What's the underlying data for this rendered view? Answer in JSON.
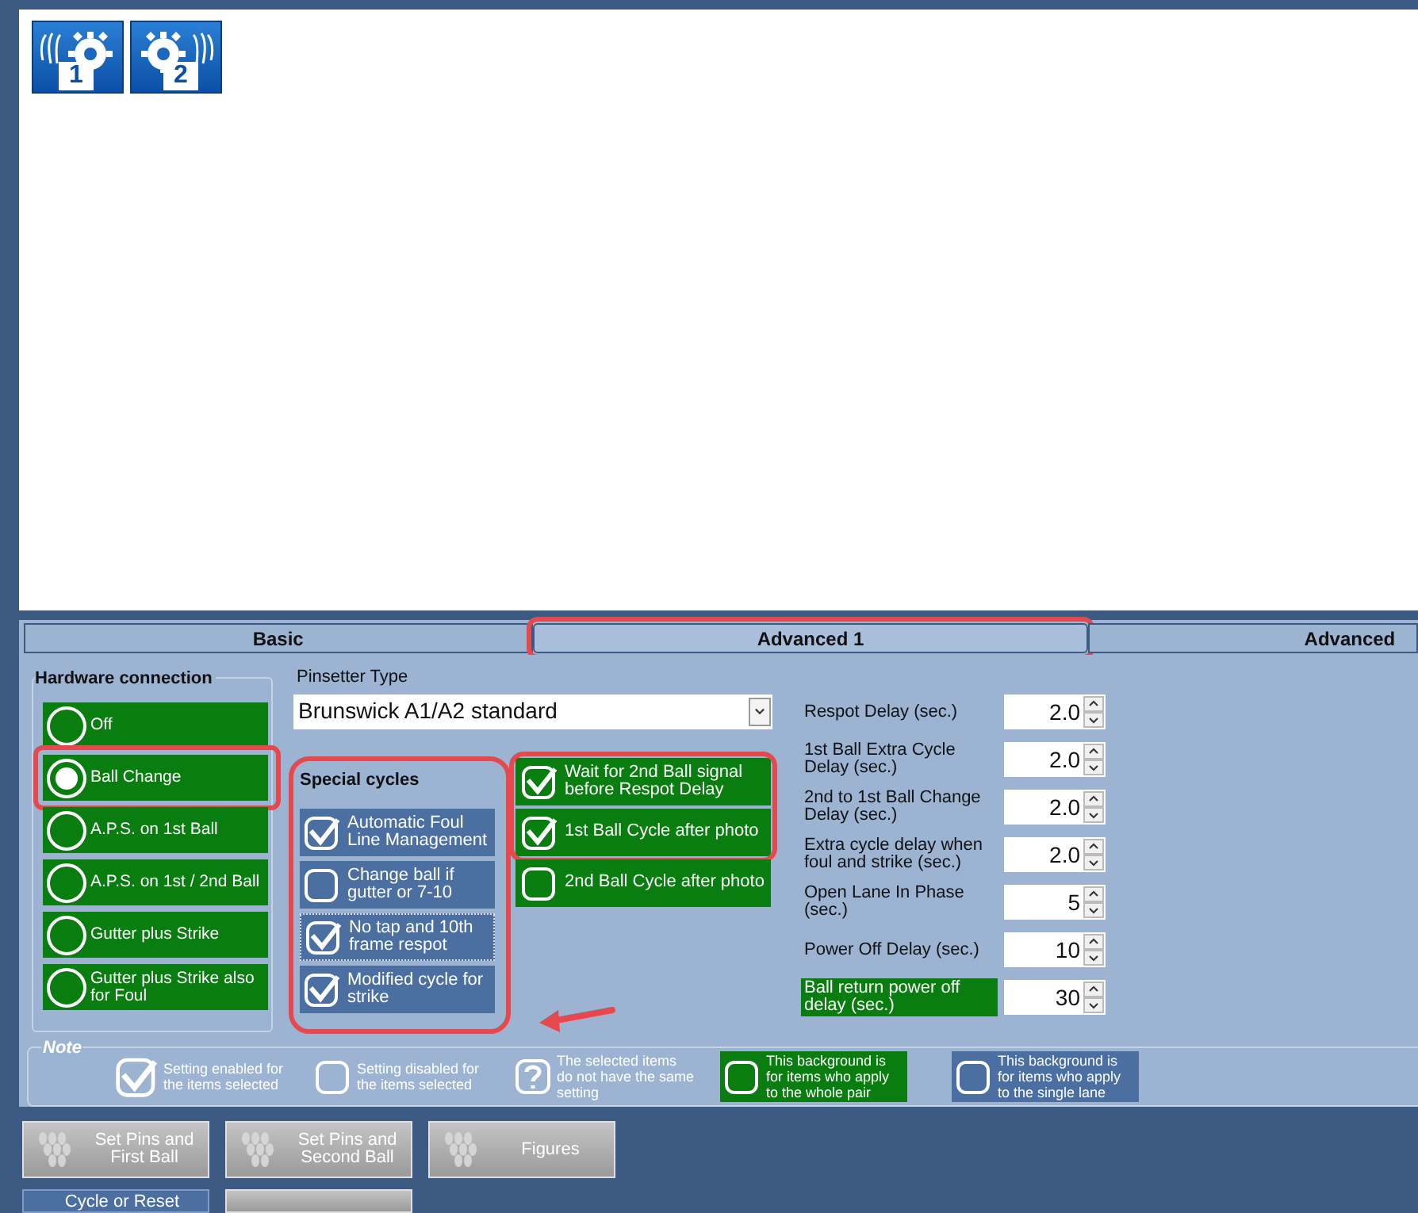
{
  "toolbar": [
    {
      "label": "1"
    },
    {
      "label": "2"
    }
  ],
  "tabs": [
    {
      "label": "Basic",
      "selected": false,
      "highlighted": false
    },
    {
      "label": "Advanced 1",
      "selected": true,
      "highlighted": true
    },
    {
      "label": "Advanced",
      "selected": false,
      "highlighted": false
    }
  ],
  "hardware_connection": {
    "title": "Hardware connection",
    "options": [
      {
        "label": "Off",
        "selected": false,
        "highlighted": false
      },
      {
        "label": "Ball Change",
        "selected": true,
        "highlighted": true
      },
      {
        "label": "A.P.S. on 1st Ball",
        "selected": false,
        "highlighted": false
      },
      {
        "label": "A.P.S. on 1st / 2nd Ball",
        "selected": false,
        "highlighted": false
      },
      {
        "label": "Gutter plus Strike",
        "selected": false,
        "highlighted": false
      },
      {
        "label": "Gutter plus Strike also for Foul",
        "selected": false,
        "highlighted": false
      }
    ]
  },
  "pinsetter_type": {
    "label": "Pinsetter Type",
    "value": "Brunswick A1/A2 standard"
  },
  "special_cycles": {
    "title": "Special cycles",
    "highlighted": true,
    "items": [
      {
        "label": "Automatic Foul Line Management",
        "checked": true,
        "focused": false
      },
      {
        "label": "Change ball if gutter or 7-10",
        "checked": false,
        "focused": false
      },
      {
        "label": "No tap and 10th frame respot",
        "checked": true,
        "focused": true
      },
      {
        "label": "Modified cycle for strike",
        "checked": true,
        "focused": false
      }
    ]
  },
  "pair_cycles": [
    {
      "highlighted": true,
      "items": [
        {
          "label": "Wait for 2nd Ball signal before Respot Delay",
          "checked": true
        },
        {
          "label": "1st Ball Cycle after photo",
          "checked": true
        }
      ]
    },
    {
      "highlighted": false,
      "items": [
        {
          "label": "2nd Ball Cycle after photo",
          "checked": false
        }
      ]
    }
  ],
  "delays": [
    {
      "label": "Respot Delay (sec.)",
      "value": "2.0",
      "pair": false
    },
    {
      "label": "1st Ball Extra Cycle Delay (sec.)",
      "value": "2.0",
      "pair": false
    },
    {
      "label": "2nd to 1st Ball Change Delay (sec.)",
      "value": "2.0",
      "pair": false
    },
    {
      "label": "Extra cycle delay when foul and strike (sec.)",
      "value": "2.0",
      "pair": false
    },
    {
      "label": "Open Lane In Phase (sec.)",
      "value": "5",
      "pair": false
    },
    {
      "label": "Power Off Delay (sec.)",
      "value": "10",
      "pair": false
    },
    {
      "label": "Ball return power off delay (sec.)",
      "value": "30",
      "pair": true
    }
  ],
  "note": {
    "title": "Note",
    "items": [
      {
        "kind": "checked",
        "label": "Setting enabled for the items selected"
      },
      {
        "kind": "unchecked",
        "label": "Setting disabled for the items selected"
      },
      {
        "kind": "mixed",
        "label": "The selected items do not have the same setting"
      },
      {
        "kind": "pair",
        "label": "This background is for items who apply to the whole pair"
      },
      {
        "kind": "single",
        "label": "This background is for items who apply to the single lane"
      }
    ]
  },
  "actions": [
    {
      "label": "Set Pins and First Ball",
      "selected": false
    },
    {
      "label": "Set Pins and Second Ball",
      "selected": false
    },
    {
      "label": "Figures",
      "selected": false
    },
    {
      "label": "Cycle or Reset",
      "selected": true
    },
    {
      "selected": false
    }
  ]
}
